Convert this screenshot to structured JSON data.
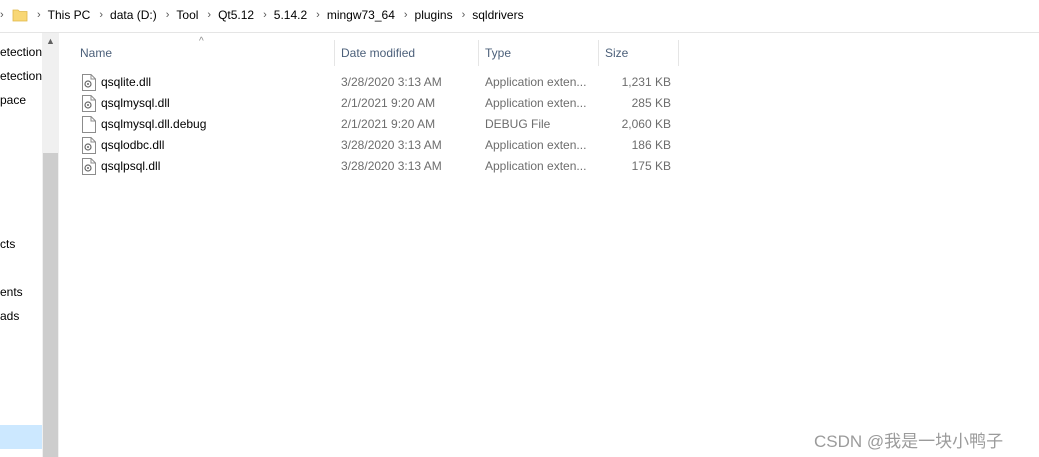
{
  "address_bar": {
    "crumbs": [
      "This PC",
      "data (D:)",
      "Tool",
      "Qt5.12",
      "5.14.2",
      "mingw73_64",
      "plugins",
      "sqldrivers"
    ]
  },
  "nav_pane": {
    "items": [
      "etection",
      "etection",
      "pace",
      "cts",
      "ents",
      "ads"
    ]
  },
  "columns": {
    "name": "Name",
    "date": "Date modified",
    "type": "Type",
    "size": "Size"
  },
  "files": [
    {
      "name": "qsqlite.dll",
      "date": "3/28/2020 3:13 AM",
      "type": "Application exten...",
      "size": "1,231 KB",
      "icon": "dll-file-icon"
    },
    {
      "name": "qsqlmysql.dll",
      "date": "2/1/2021 9:20 AM",
      "type": "Application exten...",
      "size": "285 KB",
      "icon": "dll-file-icon"
    },
    {
      "name": "qsqlmysql.dll.debug",
      "date": "2/1/2021 9:20 AM",
      "type": "DEBUG File",
      "size": "2,060 KB",
      "icon": "generic-file-icon"
    },
    {
      "name": "qsqlodbc.dll",
      "date": "3/28/2020 3:13 AM",
      "type": "Application exten...",
      "size": "186 KB",
      "icon": "dll-file-icon"
    },
    {
      "name": "qsqlpsql.dll",
      "date": "3/28/2020 3:13 AM",
      "type": "Application exten...",
      "size": "175 KB",
      "icon": "dll-file-icon"
    }
  ],
  "watermark": "CSDN @我是一块小鸭子",
  "colors": {
    "header_text": "#4c607a",
    "detail_text": "#6d6d6d",
    "selection": "#cce8ff",
    "folder": "#f8d775"
  }
}
